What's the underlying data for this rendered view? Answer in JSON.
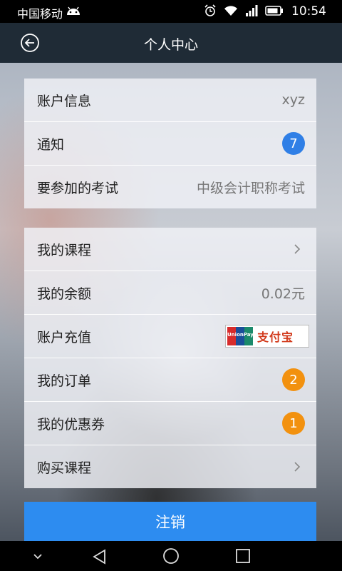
{
  "status_bar": {
    "carrier": "中国移动",
    "time": "10:54",
    "icons": [
      "android-icon",
      "alarm-icon",
      "wifi-icon",
      "signal-icon",
      "battery-icon"
    ]
  },
  "header": {
    "title": "个人中心",
    "back_icon": "back-circle-icon"
  },
  "account_section": {
    "items": [
      {
        "label": "账户信息",
        "value": "xyz"
      },
      {
        "label": "通知",
        "badge": "7",
        "badge_color": "#2f7fe6"
      },
      {
        "label": "要参加的考试",
        "value": "中级会计职称考试"
      }
    ]
  },
  "service_section": {
    "items": [
      {
        "label": "我的课程",
        "icon": "chevron-right-icon"
      },
      {
        "label": "我的余额",
        "value": "0.02元"
      },
      {
        "label": "账户充值",
        "payment_logos": [
          "UnionPay",
          "支付宝"
        ]
      },
      {
        "label": "我的订单",
        "badge": "2",
        "badge_color": "#f2910f"
      },
      {
        "label": "我的优惠券",
        "badge": "1",
        "badge_color": "#f2910f"
      },
      {
        "label": "购买课程",
        "icon": "chevron-right-icon"
      }
    ]
  },
  "logout": {
    "label": "注销"
  },
  "nav_bar": {
    "icons": [
      "chevron-down-icon",
      "back-triangle-icon",
      "home-circle-icon",
      "recent-square-icon"
    ]
  }
}
